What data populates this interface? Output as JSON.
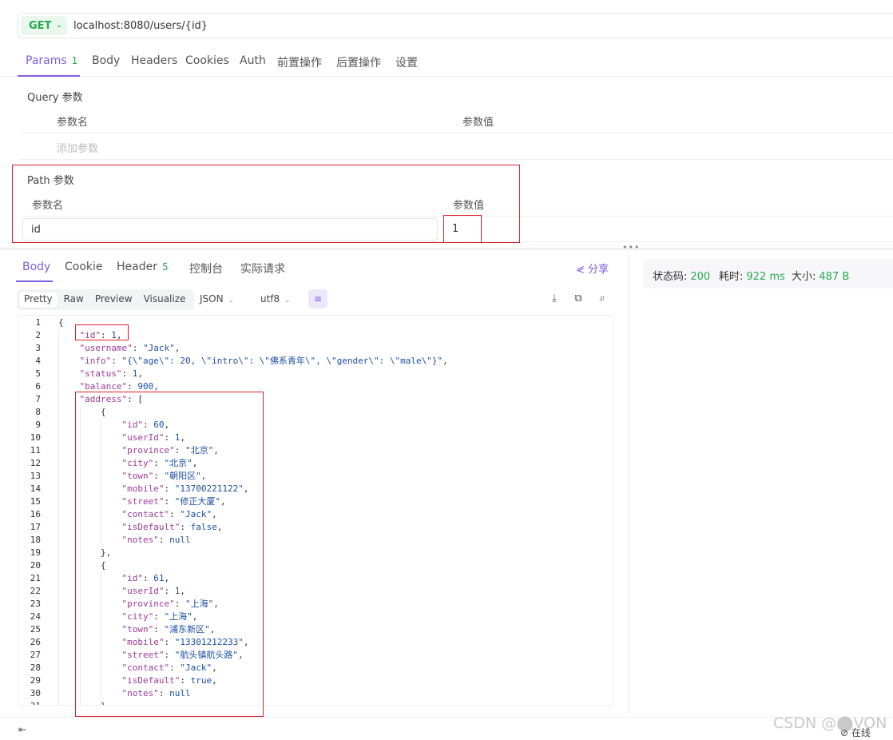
{
  "request": {
    "method": "GET",
    "url": "localhost:8080/users/{id}"
  },
  "request_tabs": [
    {
      "label": "Params",
      "count": "1"
    },
    {
      "label": "Body"
    },
    {
      "label": "Headers"
    },
    {
      "label": "Cookies"
    },
    {
      "label": "Auth"
    },
    {
      "label": "前置操作"
    },
    {
      "label": "后置操作"
    },
    {
      "label": "设置"
    }
  ],
  "query_params": {
    "title": "Query 参数",
    "name_header": "参数名",
    "value_header": "参数值",
    "add_placeholder": "添加参数"
  },
  "path_params": {
    "title": "Path 参数",
    "name_header": "参数名",
    "value_header": "参数值",
    "rows": [
      {
        "name": "id",
        "value": "1"
      }
    ]
  },
  "response_tabs": [
    {
      "label": "Body"
    },
    {
      "label": "Cookie"
    },
    {
      "label": "Header",
      "count": "5"
    },
    {
      "label": "控制台"
    },
    {
      "label": "实际请求"
    }
  ],
  "share_label": "分享",
  "view_modes": [
    "Pretty",
    "Raw",
    "Preview",
    "Visualize"
  ],
  "active_view_mode": "Pretty",
  "format_select": "JSON",
  "encoding_select": "utf8",
  "status": {
    "code_label": "状态码:",
    "code": "200",
    "time_label": "耗时:",
    "time": "922 ms",
    "size_label": "大小:",
    "size": "487 B"
  },
  "code_lines": [
    {
      "n": "1",
      "indent": 0,
      "text": "{"
    },
    {
      "n": "2",
      "indent": 1,
      "key": "id",
      "val": "1",
      "type": "n",
      "comma": true
    },
    {
      "n": "3",
      "indent": 1,
      "key": "username",
      "val": "\"Jack\"",
      "type": "s",
      "comma": true
    },
    {
      "n": "4",
      "indent": 1,
      "key": "info",
      "val": "\"{\\\"age\\\": 20, \\\"intro\\\": \\\"佛系青年\\\", \\\"gender\\\": \\\"male\\\"}\"",
      "type": "s",
      "comma": true
    },
    {
      "n": "5",
      "indent": 1,
      "key": "status",
      "val": "1",
      "type": "n",
      "comma": true
    },
    {
      "n": "6",
      "indent": 1,
      "key": "balance",
      "val": "900",
      "type": "n",
      "comma": true
    },
    {
      "n": "7",
      "indent": 1,
      "key": "address",
      "val": "[",
      "type": "p",
      "comma": false
    },
    {
      "n": "8",
      "indent": 2,
      "text": "{"
    },
    {
      "n": "9",
      "indent": 3,
      "key": "id",
      "val": "60",
      "type": "n",
      "comma": true
    },
    {
      "n": "10",
      "indent": 3,
      "key": "userId",
      "val": "1",
      "type": "n",
      "comma": true
    },
    {
      "n": "11",
      "indent": 3,
      "key": "province",
      "val": "\"北京\"",
      "type": "s",
      "comma": true
    },
    {
      "n": "12",
      "indent": 3,
      "key": "city",
      "val": "\"北京\"",
      "type": "s",
      "comma": true
    },
    {
      "n": "13",
      "indent": 3,
      "key": "town",
      "val": "\"朝阳区\"",
      "type": "s",
      "comma": true
    },
    {
      "n": "14",
      "indent": 3,
      "key": "mobile",
      "val": "\"13700221122\"",
      "type": "s",
      "comma": true
    },
    {
      "n": "15",
      "indent": 3,
      "key": "street",
      "val": "\"修正大厦\"",
      "type": "s",
      "comma": true
    },
    {
      "n": "16",
      "indent": 3,
      "key": "contact",
      "val": "\"Jack\"",
      "type": "s",
      "comma": true
    },
    {
      "n": "17",
      "indent": 3,
      "key": "isDefault",
      "val": "false",
      "type": "n",
      "comma": true
    },
    {
      "n": "18",
      "indent": 3,
      "key": "notes",
      "val": "null",
      "type": "n",
      "comma": false
    },
    {
      "n": "19",
      "indent": 2,
      "text": "},"
    },
    {
      "n": "20",
      "indent": 2,
      "text": "{"
    },
    {
      "n": "21",
      "indent": 3,
      "key": "id",
      "val": "61",
      "type": "n",
      "comma": true
    },
    {
      "n": "22",
      "indent": 3,
      "key": "userId",
      "val": "1",
      "type": "n",
      "comma": true
    },
    {
      "n": "23",
      "indent": 3,
      "key": "province",
      "val": "\"上海\"",
      "type": "s",
      "comma": true
    },
    {
      "n": "24",
      "indent": 3,
      "key": "city",
      "val": "\"上海\"",
      "type": "s",
      "comma": true
    },
    {
      "n": "25",
      "indent": 3,
      "key": "town",
      "val": "\"浦东新区\"",
      "type": "s",
      "comma": true
    },
    {
      "n": "26",
      "indent": 3,
      "key": "mobile",
      "val": "\"13301212233\"",
      "type": "s",
      "comma": true
    },
    {
      "n": "27",
      "indent": 3,
      "key": "street",
      "val": "\"航头镇航头路\"",
      "type": "s",
      "comma": true
    },
    {
      "n": "28",
      "indent": 3,
      "key": "contact",
      "val": "\"Jack\"",
      "type": "s",
      "comma": true
    },
    {
      "n": "29",
      "indent": 3,
      "key": "isDefault",
      "val": "true",
      "type": "n",
      "comma": true
    },
    {
      "n": "30",
      "indent": 3,
      "key": "notes",
      "val": "null",
      "type": "n",
      "comma": false
    },
    {
      "n": "31",
      "indent": 2,
      "text": "}"
    }
  ],
  "bottom": {
    "online_label": "在线"
  },
  "watermark": "CSDN @⬤VON",
  "colors": {
    "accent": "#7b5fe0",
    "success": "#27a94f",
    "highlight_box": "#d8222a"
  }
}
